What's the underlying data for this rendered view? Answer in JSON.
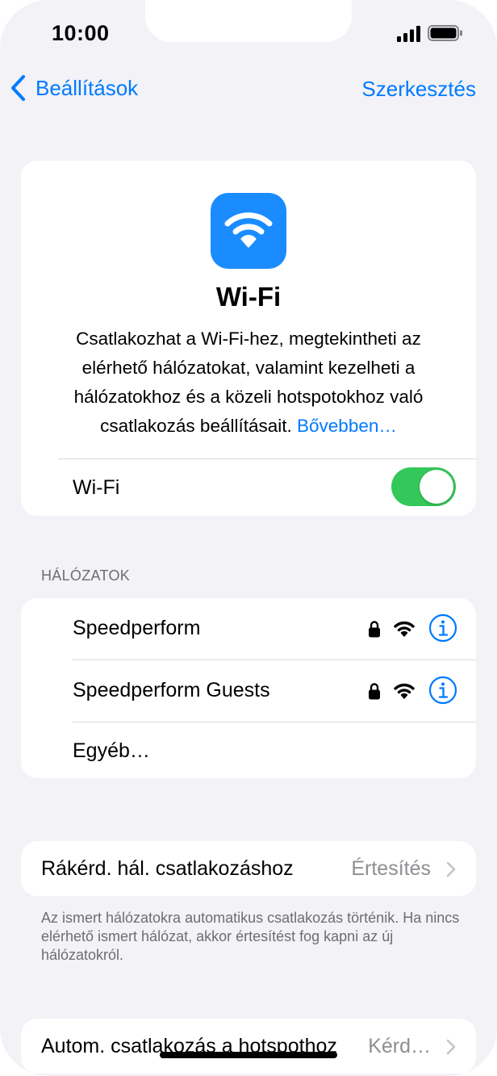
{
  "status_bar": {
    "time": "10:00"
  },
  "nav": {
    "back_label": "Beállítások",
    "edit_label": "Szerkesztés"
  },
  "hero": {
    "title": "Wi-Fi",
    "description": "Csatlakozhat a Wi-Fi-hez, megtekintheti az elérhető hálózatokat, valamint kezelheti a hálózatokhoz és a közeli hotspotokhoz való csatlakozás beállításait.",
    "more_link": "Bővebben…",
    "toggle_label": "Wi-Fi",
    "toggle_on": true
  },
  "networks": {
    "header": "HÁLÓZATOK",
    "items": [
      {
        "name": "Speedperform",
        "locked": true
      },
      {
        "name": "Speedperform Guests",
        "locked": true
      }
    ],
    "other_label": "Egyéb…"
  },
  "ask_to_join": {
    "label": "Rákérd. hál. csatlakozáshoz",
    "value": "Értesítés",
    "footnote": "Az ismert hálózatokra automatikus csatlakozás történik. Ha nincs elérhető ismert hálózat, akkor értesítést fog kapni az új hálózatokról."
  },
  "auto_hotspot": {
    "label": "Autom. csatlakozás a hotspothoz",
    "value": "Kérd…"
  },
  "colors": {
    "accent": "#007aff",
    "toggle_on": "#34c759",
    "background": "#f2f2f7",
    "wifi_icon_bg": "#1a8cff"
  }
}
